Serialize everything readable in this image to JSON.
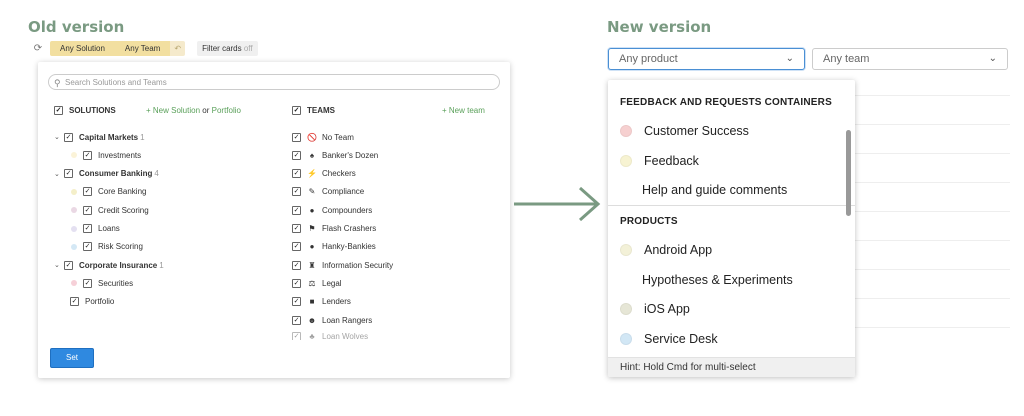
{
  "old_version": {
    "heading": "Old version",
    "toolbar": {
      "any_solution": "Any Solution",
      "any_team": "Any Team",
      "undo": "↶",
      "filter_cards": "Filter cards",
      "filter_state": "off"
    },
    "search_placeholder": "Search Solutions and Teams",
    "solutions": {
      "header": "SOLUTIONS",
      "new_solution": "+ New Solution",
      "or": "or",
      "portfolio": "Portfolio",
      "rows": [
        {
          "label": "Capital Markets",
          "count": "1",
          "group": true,
          "dot": ""
        },
        {
          "label": "Investments",
          "group": false,
          "dot": "#fbf3d8"
        },
        {
          "label": "Consumer Banking",
          "count": "4",
          "group": true,
          "dot": ""
        },
        {
          "label": "Core Banking",
          "group": false,
          "dot": "#f4efc9"
        },
        {
          "label": "Credit Scoring",
          "group": false,
          "dot": "#ead8e4"
        },
        {
          "label": "Loans",
          "group": false,
          "dot": "#e4e0f1"
        },
        {
          "label": "Risk Scoring",
          "group": false,
          "dot": "#d4e8f5"
        },
        {
          "label": "Corporate Insurance",
          "count": "1",
          "group": true,
          "dot": ""
        },
        {
          "label": "Securities",
          "group": false,
          "dot": "#f6d0d8"
        },
        {
          "label": "Portfolio",
          "group": false,
          "dot": "",
          "top_level": true
        }
      ]
    },
    "teams": {
      "header": "TEAMS",
      "new_team": "+ New team",
      "rows": [
        {
          "label": "No Team",
          "icon": "🚫",
          "icon_name": "no-team-icon"
        },
        {
          "label": "Banker's Dozen",
          "icon": "♠",
          "icon_name": "spade-icon"
        },
        {
          "label": "Checkers",
          "icon": "⚡",
          "icon_name": "lightning-icon"
        },
        {
          "label": "Compliance",
          "icon": "✎",
          "icon_name": "pencil-icon"
        },
        {
          "label": "Compounders",
          "icon": "●",
          "icon_name": "coin-icon"
        },
        {
          "label": "Flash Crashers",
          "icon": "⚑",
          "icon_name": "flag-icon"
        },
        {
          "label": "Hanky-Bankies",
          "icon": "●",
          "icon_name": "ball-icon"
        },
        {
          "label": "Information Security",
          "icon": "♜",
          "icon_name": "shield-icon"
        },
        {
          "label": "Legal",
          "icon": "⚖",
          "icon_name": "scale-icon"
        },
        {
          "label": "Lenders",
          "icon": "■",
          "icon_name": "book-icon"
        },
        {
          "label": "Loan Rangers",
          "icon": "☻",
          "icon_name": "sunglasses-icon"
        },
        {
          "label": "Loan Wolves",
          "icon": "♣",
          "icon_name": "wolf-icon"
        }
      ]
    },
    "set_button": "Set"
  },
  "new_version": {
    "heading": "New version",
    "product_select": "Any product",
    "team_select": "Any team",
    "dropdown": {
      "section_feedback": "FEEDBACK AND REQUESTS CONTAINERS",
      "feedback_items": [
        {
          "label": "Customer Success",
          "dot": "#f6d0d0"
        },
        {
          "label": "Feedback",
          "dot": "#f7f3d2"
        },
        {
          "label": "Help and guide comments",
          "dot": ""
        }
      ],
      "section_products": "PRODUCTS",
      "product_items": [
        {
          "label": "Android App",
          "dot": "#f3f1d8"
        },
        {
          "label": "Hypotheses & Experiments",
          "dot": ""
        },
        {
          "label": "iOS App",
          "dot": "#e6e6d6"
        },
        {
          "label": "Service Desk",
          "dot": "#d2e7f5"
        }
      ],
      "hint": "Hint: Hold Cmd for multi-select"
    }
  },
  "colors": {
    "heading": "#7a9a82",
    "arrow": "#7a9a82",
    "primary_button": "#2f89e0",
    "new_link": "#5aa05a",
    "toolbar_pill": "#f2dfa0"
  }
}
